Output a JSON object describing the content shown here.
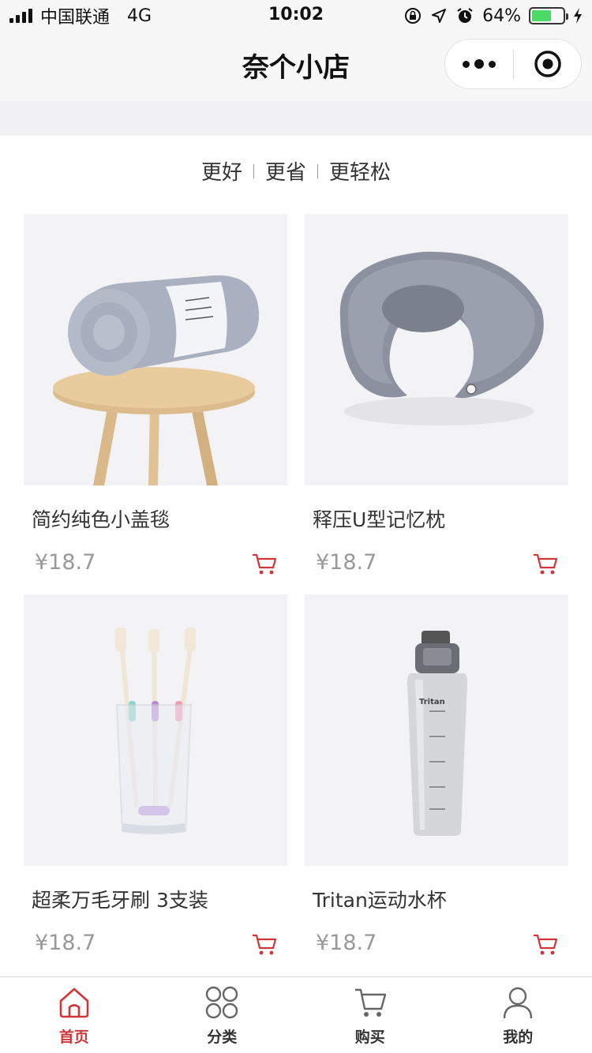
{
  "status_bar": {
    "carrier": "中国联通",
    "network": "4G",
    "time": "10:02",
    "battery_percent": "64%",
    "battery_level": 0.64
  },
  "nav": {
    "title": "奈个小店"
  },
  "slogans": [
    "更好",
    "更省",
    "更轻松"
  ],
  "products": [
    {
      "name": "简约纯色小盖毯",
      "price": "¥18.7",
      "image": "rolled-blanket-on-stool"
    },
    {
      "name": "释压U型记忆枕",
      "price": "¥18.7",
      "image": "u-shaped-neck-pillow"
    },
    {
      "name": "超柔万毛牙刷 3支装",
      "price": "¥18.7",
      "image": "toothbrushes-in-glass"
    },
    {
      "name": "Tritan运动水杯",
      "price": "¥18.7",
      "image": "sports-water-bottle",
      "bottle_brand": "Tritan"
    }
  ],
  "tabbar": {
    "items": [
      {
        "label": "首页",
        "icon": "home-icon",
        "active": true
      },
      {
        "label": "分类",
        "icon": "category-icon",
        "active": false
      },
      {
        "label": "购买",
        "icon": "cart-icon",
        "active": false
      },
      {
        "label": "我的",
        "icon": "profile-icon",
        "active": false
      }
    ]
  },
  "colors": {
    "accent": "#d0353a",
    "price": "#999999",
    "background": "#ffffff",
    "band": "#f1f1f4"
  }
}
